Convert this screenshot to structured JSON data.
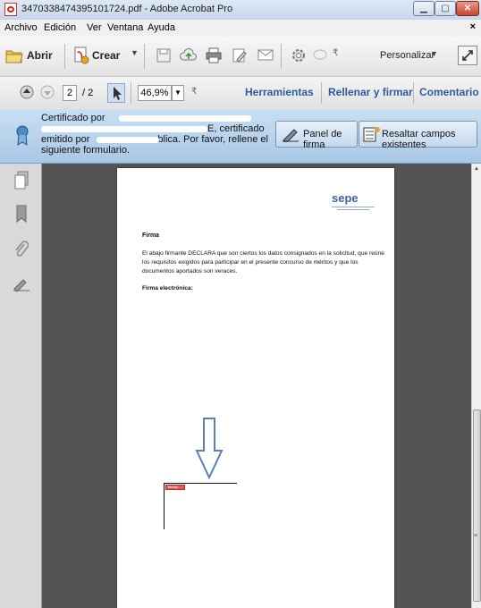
{
  "window": {
    "title": "3470338474395101724.pdf - Adobe Acrobat Pro"
  },
  "menu": {
    "items": [
      "Archivo",
      "Edición",
      "Ver",
      "Ventana",
      "Ayuda"
    ],
    "close_glyph": "×"
  },
  "toolbar": {
    "open_label": "Abrir",
    "create_label": "Crear",
    "customize_label": "Personalizar"
  },
  "nav": {
    "current_page": "2",
    "total_pages": "/ 2",
    "zoom": "46,9%",
    "tools_label": "Herramientas",
    "fill_sign_label": "Rellenar y firmar",
    "comment_label": "Comentario"
  },
  "cert": {
    "line1": "Certificado por",
    "line2_end": "E, certificado",
    "line3_start": "emitido por",
    "line3_end": "blica.  Por favor, rellene el",
    "line4": "siguiente formulario.",
    "signature_panel_label": "Panel de firma",
    "highlight_fields_label": "Resaltar campos existentes"
  },
  "document": {
    "logo": "sepe",
    "heading": "Firma",
    "paragraph_lines": [
      "El abajo firmante DECLARA que son ciertos los datos consignados en la solicitud, que reúne",
      "los requisitos exigidos para participar en el presente concurso de méritos y que los",
      "documentos aportados son veraces."
    ],
    "signature_label": "Firma electrónica:",
    "signature_field_tag": "firmas"
  },
  "colors": {
    "titlebar": "#c6d6ea",
    "certbar": "#a9c8e6",
    "link": "#2b5c9b",
    "arrow": "#5a7fb8",
    "doc_background": "#545454"
  }
}
